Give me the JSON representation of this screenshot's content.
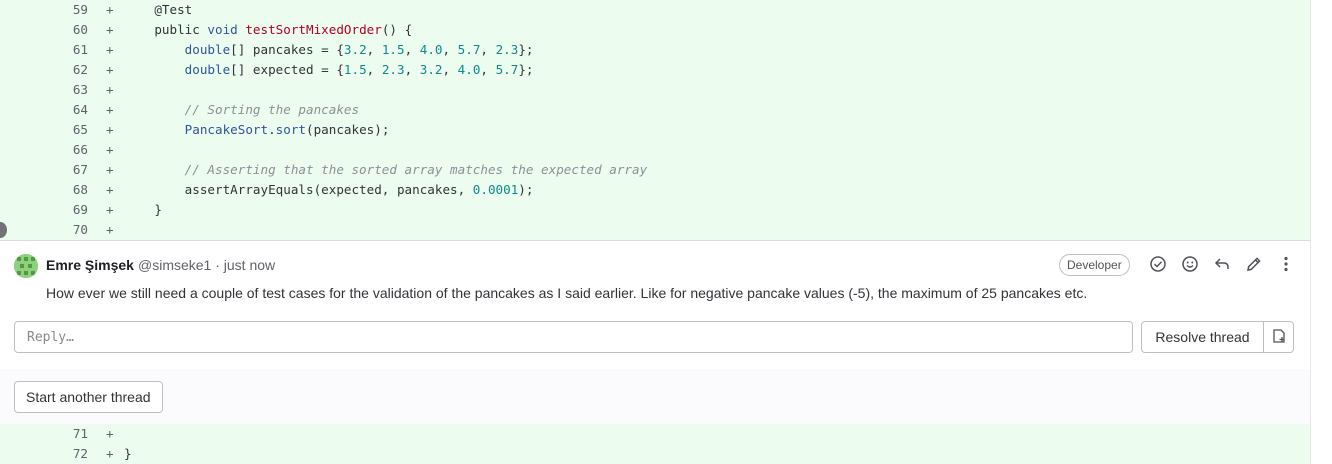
{
  "diff": {
    "top_lines": [
      {
        "num": "59",
        "sign": "+",
        "indent": "    ",
        "tokens": [
          {
            "t": "@Test",
            "c": ""
          }
        ]
      },
      {
        "num": "60",
        "sign": "+",
        "indent": "    ",
        "tokens": [
          {
            "t": "public ",
            "c": ""
          },
          {
            "t": "void ",
            "c": "kw"
          },
          {
            "t": "testSortMixedOrder",
            "c": "fn"
          },
          {
            "t": "() {",
            "c": ""
          }
        ]
      },
      {
        "num": "61",
        "sign": "+",
        "indent": "        ",
        "tokens": [
          {
            "t": "double",
            "c": "kw"
          },
          {
            "t": "[] pancakes = {",
            "c": ""
          },
          {
            "t": "3.2",
            "c": "num"
          },
          {
            "t": ", ",
            "c": ""
          },
          {
            "t": "1.5",
            "c": "num"
          },
          {
            "t": ", ",
            "c": ""
          },
          {
            "t": "4.0",
            "c": "num"
          },
          {
            "t": ", ",
            "c": ""
          },
          {
            "t": "5.7",
            "c": "num"
          },
          {
            "t": ", ",
            "c": ""
          },
          {
            "t": "2.3",
            "c": "num"
          },
          {
            "t": "};",
            "c": ""
          }
        ]
      },
      {
        "num": "62",
        "sign": "+",
        "indent": "        ",
        "tokens": [
          {
            "t": "double",
            "c": "kw"
          },
          {
            "t": "[] expected = {",
            "c": ""
          },
          {
            "t": "1.5",
            "c": "num"
          },
          {
            "t": ", ",
            "c": ""
          },
          {
            "t": "2.3",
            "c": "num"
          },
          {
            "t": ", ",
            "c": ""
          },
          {
            "t": "3.2",
            "c": "num"
          },
          {
            "t": ", ",
            "c": ""
          },
          {
            "t": "4.0",
            "c": "num"
          },
          {
            "t": ", ",
            "c": ""
          },
          {
            "t": "5.7",
            "c": "num"
          },
          {
            "t": "};",
            "c": ""
          }
        ]
      },
      {
        "num": "63",
        "sign": "+",
        "indent": "",
        "tokens": []
      },
      {
        "num": "64",
        "sign": "+",
        "indent": "        ",
        "tokens": [
          {
            "t": "// Sorting the pancakes",
            "c": "cm"
          }
        ]
      },
      {
        "num": "65",
        "sign": "+",
        "indent": "        ",
        "tokens": [
          {
            "t": "PancakeSort",
            "c": "ty"
          },
          {
            "t": ".",
            "c": ""
          },
          {
            "t": "sort",
            "c": "ty"
          },
          {
            "t": "(pancakes);",
            "c": ""
          }
        ]
      },
      {
        "num": "66",
        "sign": "+",
        "indent": "",
        "tokens": []
      },
      {
        "num": "67",
        "sign": "+",
        "indent": "        ",
        "tokens": [
          {
            "t": "// Asserting that the sorted array matches the expected array",
            "c": "cm"
          }
        ]
      },
      {
        "num": "68",
        "sign": "+",
        "indent": "        ",
        "tokens": [
          {
            "t": "assertArrayEquals(expected, pancakes, ",
            "c": ""
          },
          {
            "t": "0.0001",
            "c": "num"
          },
          {
            "t": ");",
            "c": ""
          }
        ]
      },
      {
        "num": "69",
        "sign": "+",
        "indent": "    ",
        "tokens": [
          {
            "t": "}",
            "c": ""
          }
        ]
      },
      {
        "num": "70",
        "sign": "+",
        "indent": "",
        "tokens": []
      }
    ],
    "bottom_lines": [
      {
        "num": "71",
        "sign": "+",
        "indent": "",
        "tokens": []
      },
      {
        "num": "72",
        "sign": "+",
        "indent": "",
        "tokens": [
          {
            "t": "}",
            "c": ""
          }
        ]
      }
    ]
  },
  "note": {
    "author": "Emre Şimşek",
    "meta": "@simseke1 · just now",
    "role": "Developer",
    "body": "How ever we still need a couple of test cases for the validation of the pancakes as I said earlier. Like for negative pancake values (-5), the maximum of 25 pancakes etc.",
    "actions": [
      {
        "name": "resolve-check-icon",
        "glyph": "✓"
      },
      {
        "name": "emoji-reaction-icon",
        "glyph": "☺"
      },
      {
        "name": "reply-icon",
        "glyph": "↩"
      },
      {
        "name": "edit-pencil-icon",
        "glyph": "✎"
      },
      {
        "name": "more-actions-icon",
        "glyph": "⋮"
      }
    ]
  },
  "reply": {
    "placeholder": "Reply…"
  },
  "buttons": {
    "resolve": "Resolve thread",
    "start_thread": "Start another thread"
  },
  "colors": {
    "added_line_bg": "#ecfdf0",
    "line_number_bg": "#d5f0dc"
  }
}
